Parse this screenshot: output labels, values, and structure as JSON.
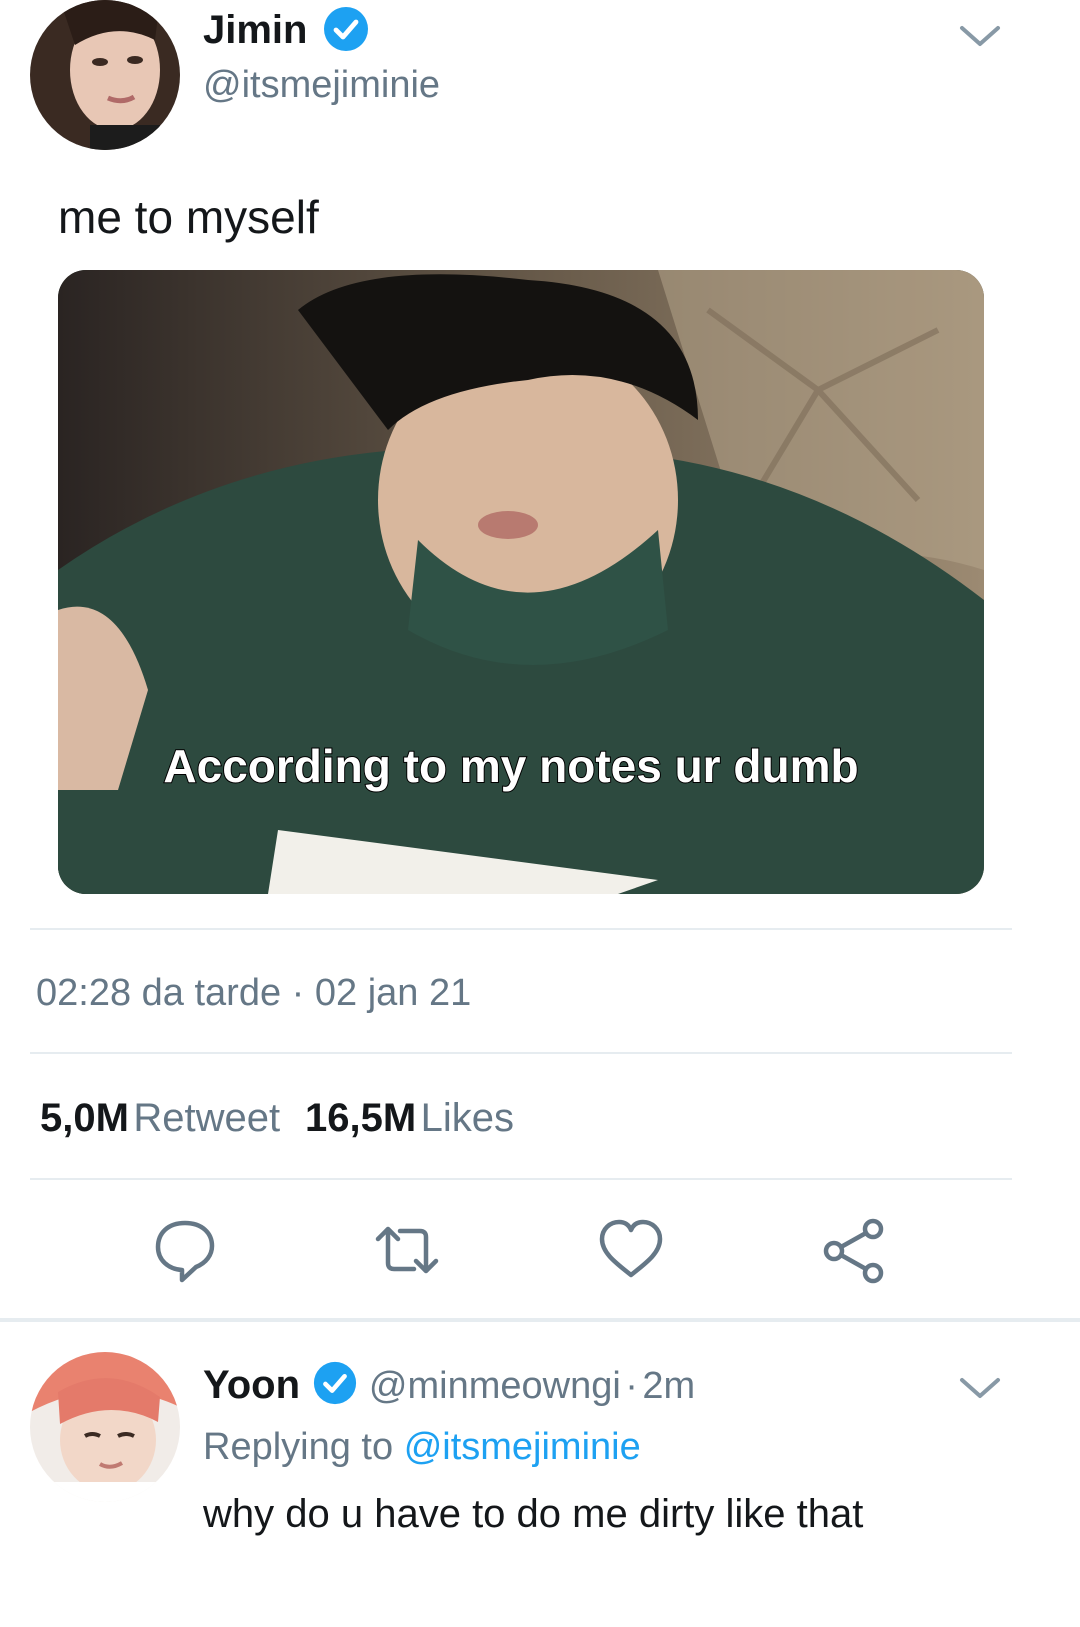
{
  "tweet": {
    "author_name": "Jimin",
    "author_handle": "@itsmejiminie",
    "text": "me to myself",
    "media_caption": "According to my notes ur dumb",
    "time": "02:28 da tarde",
    "date_sep": "·",
    "date": "02 jan 21",
    "retweets_count": "5,0M",
    "retweets_label": "Retweet",
    "likes_count": "16,5M",
    "likes_label": "Likes"
  },
  "reply": {
    "author_name": "Yoon",
    "author_handle": "@minmeowngi",
    "time_sep": "·",
    "time": "2m",
    "replying_prefix": "Replying to",
    "replying_to": "@itsmejiminie",
    "text": "why do u have to do me dirty like that"
  },
  "icons": {
    "verified": "verified-badge-icon",
    "more": "chevron-down-icon",
    "reply": "reply-bubble-icon",
    "retweet": "retweet-icon",
    "like": "heart-icon",
    "share": "share-icon"
  },
  "colors": {
    "accent": "#1da1f2",
    "text": "#14171a",
    "secondary": "#657786",
    "divider": "#e6ecf0"
  }
}
